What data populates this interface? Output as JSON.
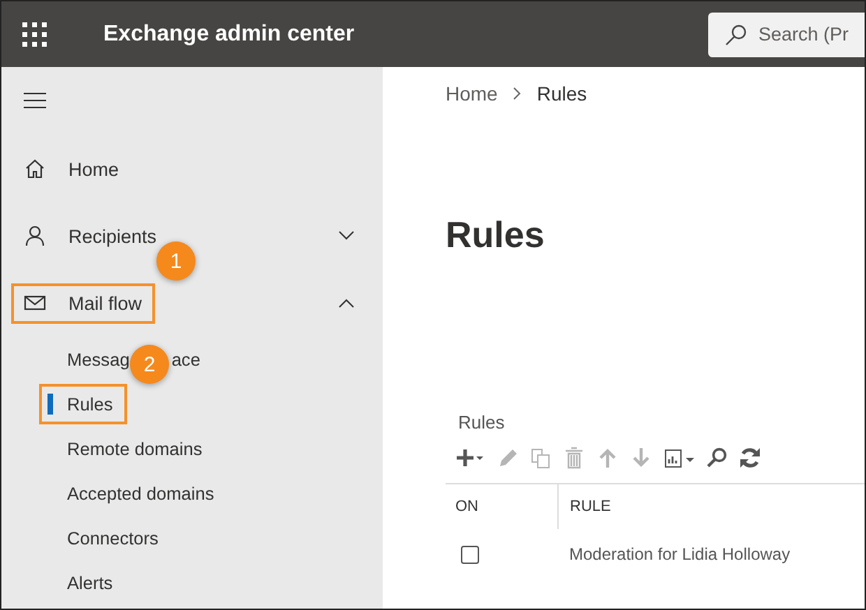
{
  "header": {
    "title": "Exchange admin center",
    "search": {
      "placeholder": "Search (Pr"
    }
  },
  "nav": [
    {
      "label": "Home"
    },
    {
      "label": "Recipients",
      "expanded": false
    },
    {
      "label": "Mail flow",
      "expanded": true,
      "highlighted": true,
      "badge": "1",
      "children": [
        {
          "label_parts": [
            "Messag",
            "ace"
          ],
          "selected": false,
          "highlighted": false
        },
        {
          "label": "Rules",
          "selected": true,
          "highlighted": true,
          "badge": "2"
        },
        {
          "label": "Remote domains",
          "selected": false,
          "highlighted": false
        },
        {
          "label": "Accepted domains",
          "selected": false,
          "highlighted": false
        },
        {
          "label": "Connectors",
          "selected": false,
          "highlighted": false
        },
        {
          "label": "Alerts",
          "selected": false,
          "highlighted": false
        }
      ]
    }
  ],
  "breadcrumb": [
    "Home",
    "Rules"
  ],
  "page_title": "Rules",
  "section_label": "Rules",
  "toolbar": [
    {
      "kind": "add",
      "disabled": false
    },
    {
      "kind": "edit",
      "disabled": true
    },
    {
      "kind": "copy",
      "disabled": true
    },
    {
      "kind": "delete",
      "disabled": true
    },
    {
      "kind": "up",
      "disabled": true
    },
    {
      "kind": "down",
      "disabled": true
    },
    {
      "kind": "report",
      "disabled": false
    },
    {
      "kind": "search",
      "disabled": false
    },
    {
      "kind": "refresh",
      "disabled": false
    }
  ],
  "table": {
    "columns": [
      "ON",
      "RULE"
    ],
    "rows": [
      {
        "on": false,
        "rule": "Moderation for Lidia Holloway"
      }
    ]
  }
}
